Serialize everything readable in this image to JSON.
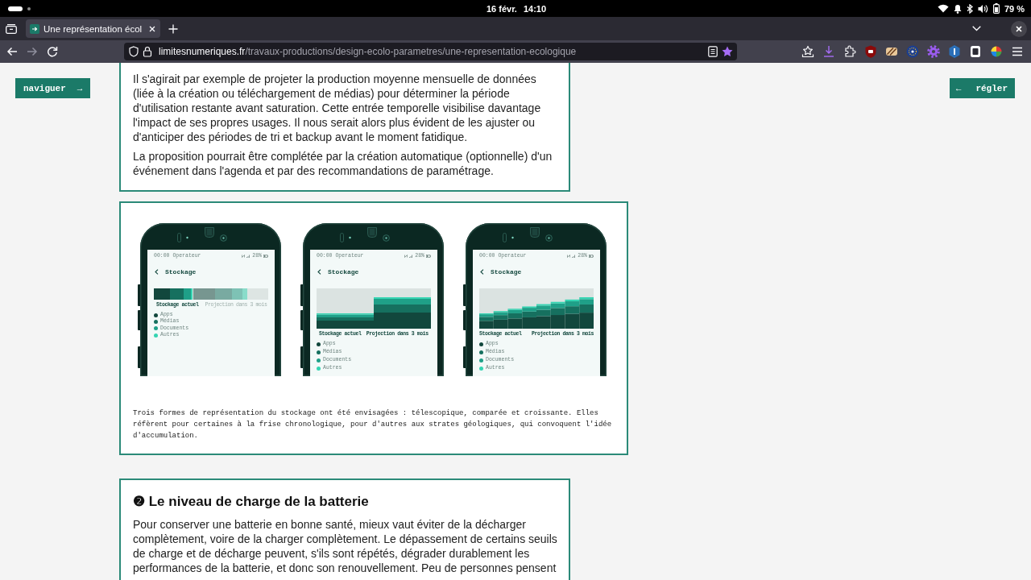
{
  "system_bar": {
    "date": "16 févr.",
    "time": "14:10",
    "battery": "79 %"
  },
  "browser": {
    "tabs": [
      {
        "title": "Une représentation écol",
        "selected": true
      }
    ],
    "nav_buttons": [
      {
        "kind": "back",
        "disabled": false
      },
      {
        "kind": "forward",
        "disabled": true
      },
      {
        "kind": "reload",
        "disabled": false
      }
    ],
    "address": {
      "domain": "limitesnumeriques.fr",
      "path": "/travaux-productions/design-ecolo-parametres/une-representation-ecologique",
      "bookmarked": true
    }
  },
  "page": {
    "side_buttons": [
      {
        "kind": "trailing",
        "label": "naviguer",
        "arrow": "→"
      },
      {
        "kind": "leading",
        "label": "régler",
        "arrow": "←"
      }
    ],
    "intro_card": {
      "paragraphs": [
        "Il s'agirait par exemple de projeter la production moyenne mensuelle de données (liée à la création ou téléchargement de médias) pour déterminer la période d'utilisation restante avant saturation. Cette entrée temporelle visibilise davantage l'impact de ses propres usages. Il nous serait alors plus évident de les ajuster ou d'anticiper des périodes de tri et backup avant le moment fatidique.",
        "La proposition pourrait être complétée par la création automatique (optionnelle) d'un événement dans l'agenda et par des recommandations de paramétrage."
      ]
    },
    "figure": {
      "phones": [
        {
          "kind": "telescopic",
          "status": "00:00 Operateur",
          "battery": "28%",
          "title": "Stockage",
          "labels": [
            {
              "text": "Stockage actuel",
              "dimmed": false
            },
            {
              "text": "Projection dans 3 mois",
              "dimmed": true
            }
          ],
          "legend": [
            {
              "label": "Apps",
              "color": "#12473d"
            },
            {
              "label": "Médias",
              "color": "#16705f"
            },
            {
              "label": "Documents",
              "color": "#1fa088"
            },
            {
              "label": "Autres",
              "color": "#35d4b2"
            }
          ]
        },
        {
          "kind": "compared",
          "status": "00:00 Operateur",
          "battery": "28%",
          "title": "Stockage",
          "labels": [
            {
              "text": "Stockage actuel",
              "dimmed": false
            },
            {
              "text": "Projection dans 3 mois",
              "dimmed": false
            }
          ],
          "legend": [
            {
              "label": "Apps",
              "color": "#12473d"
            },
            {
              "label": "Médias",
              "color": "#16705f"
            },
            {
              "label": "Documents",
              "color": "#1fa088"
            },
            {
              "label": "Autres",
              "color": "#35d4b2"
            }
          ]
        },
        {
          "kind": "growing",
          "status": "00:00 Operateur",
          "battery": "28%",
          "title": "Stockage",
          "labels": [
            {
              "text": "Stockage actuel",
              "dimmed": false
            },
            {
              "text": "Projection dans 3 mois",
              "dimmed": false
            }
          ],
          "legend": [
            {
              "label": "Apps",
              "color": "#12473d"
            },
            {
              "label": "Médias",
              "color": "#16705f"
            },
            {
              "label": "Documents",
              "color": "#1fa088"
            },
            {
              "label": "Autres",
              "color": "#35d4b2"
            }
          ]
        }
      ],
      "caption": "Trois formes de représentation du stockage ont été envisagées : télescopique, comparée et croissante. Elles réfèrent pour certaines à la frise chronologique, pour d'autres aux strates géologiques, qui convoquent l'idée d'accumulation."
    },
    "section": {
      "heading": "❷ Le niveau de charge de la batterie",
      "paragraphs": [
        "Pour conserver une batterie en bonne santé, mieux vaut éviter de la décharger complètement, voire de la charger complètement. Le dépassement de certains seuils de charge et de décharge peuvent, s'ils sont répétés, dégrader durablement les performances de la batterie, et donc son renouvellement. Peu de personnes pensent"
      ]
    }
  }
}
